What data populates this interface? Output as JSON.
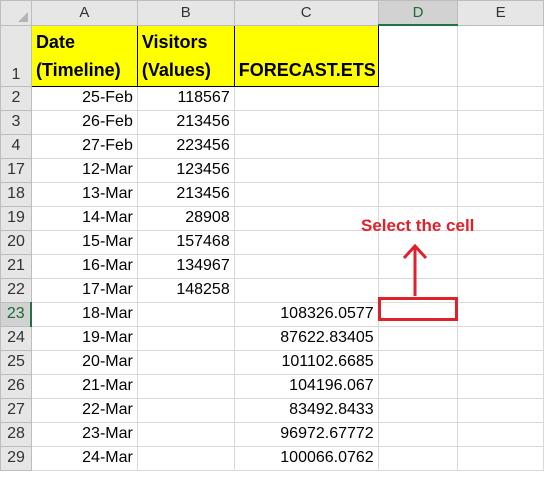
{
  "columns": [
    "A",
    "B",
    "C",
    "D",
    "E"
  ],
  "selected_column": "D",
  "header_row": {
    "row_number": "1",
    "date_line1": "Date",
    "date_line2": "(Timeline)",
    "visitors_line1": "Visitors",
    "visitors_line2": "(Values)",
    "forecast": "FORECAST.ETS"
  },
  "rows": [
    {
      "row": "2",
      "date": "25-Feb",
      "visitors": "118567",
      "forecast": ""
    },
    {
      "row": "3",
      "date": "26-Feb",
      "visitors": "213456",
      "forecast": ""
    },
    {
      "row": "4",
      "date": "27-Feb",
      "visitors": "223456",
      "forecast": ""
    },
    {
      "row": "17",
      "date": "12-Mar",
      "visitors": "123456",
      "forecast": ""
    },
    {
      "row": "18",
      "date": "13-Mar",
      "visitors": "213456",
      "forecast": ""
    },
    {
      "row": "19",
      "date": "14-Mar",
      "visitors": "28908",
      "forecast": ""
    },
    {
      "row": "20",
      "date": "15-Mar",
      "visitors": "157468",
      "forecast": ""
    },
    {
      "row": "21",
      "date": "16-Mar",
      "visitors": "134967",
      "forecast": ""
    },
    {
      "row": "22",
      "date": "17-Mar",
      "visitors": "148258",
      "forecast": ""
    },
    {
      "row": "23",
      "date": "18-Mar",
      "visitors": "",
      "forecast": "108326.0577"
    },
    {
      "row": "24",
      "date": "19-Mar",
      "visitors": "",
      "forecast": "87622.83405"
    },
    {
      "row": "25",
      "date": "20-Mar",
      "visitors": "",
      "forecast": "101102.6685"
    },
    {
      "row": "26",
      "date": "21-Mar",
      "visitors": "",
      "forecast": "104196.067"
    },
    {
      "row": "27",
      "date": "22-Mar",
      "visitors": "",
      "forecast": "83492.8433"
    },
    {
      "row": "28",
      "date": "23-Mar",
      "visitors": "",
      "forecast": "96972.67772"
    },
    {
      "row": "29",
      "date": "24-Mar",
      "visitors": "",
      "forecast": "100066.0762"
    }
  ],
  "selected_row": "23",
  "annotation": {
    "text": "Select the cell",
    "color": "#e0202a",
    "icon": "arrow-up-icon"
  },
  "colors": {
    "header_fill": "#ffff00",
    "selection_accent": "#217346"
  }
}
